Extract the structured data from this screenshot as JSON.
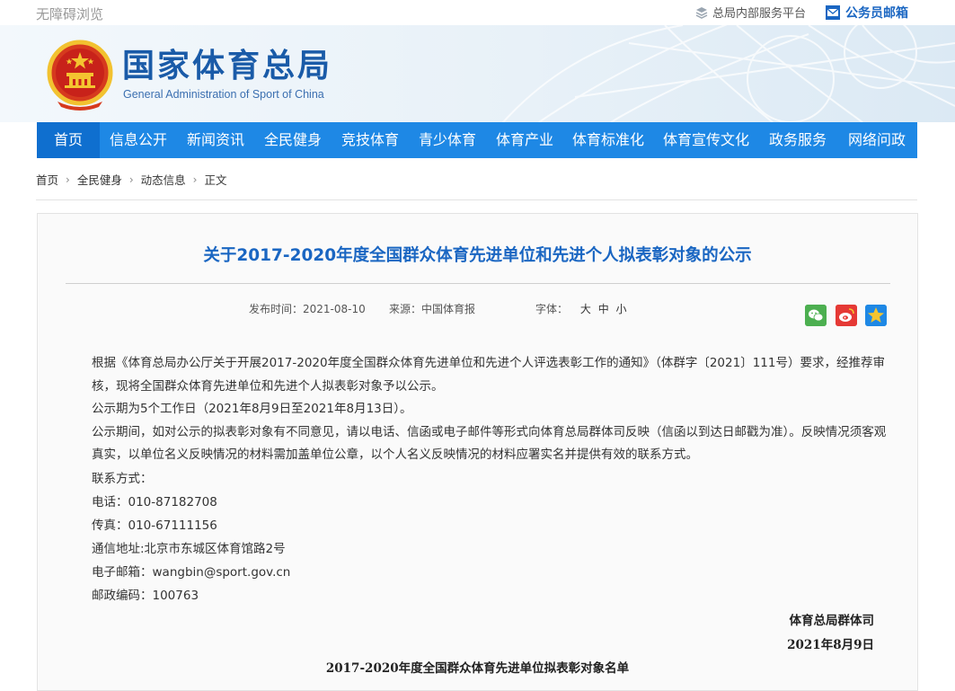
{
  "topbar": {
    "accessibility": "无障碍浏览",
    "internal_platform": "总局内部服务平台",
    "staff_mail": "公务员邮箱"
  },
  "header": {
    "title": "国家体育总局",
    "subtitle": "General Administration of Sport of China"
  },
  "nav": {
    "items": [
      "首页",
      "信息公开",
      "新闻资讯",
      "全民健身",
      "竞技体育",
      "青少体育",
      "体育产业",
      "体育标准化",
      "体育宣传文化",
      "政务服务",
      "网络问政"
    ]
  },
  "breadcrumb": {
    "items": [
      "首页",
      "全民健身",
      "动态信息",
      "正文"
    ],
    "separator": "›"
  },
  "article": {
    "title": "关于2017-2020年度全国群众体育先进单位和先进个人拟表彰对象的公示",
    "publish_label": "发布时间：",
    "publish_date": "2021-08-10",
    "source_label": "来源：",
    "source": "中国体育报",
    "font_label": "字体：",
    "font_sizes": [
      "大",
      "中",
      "小"
    ],
    "paragraphs": [
      "根据《体育总局办公厅关于开展2017-2020年度全国群众体育先进单位和先进个人评选表彰工作的通知》（体群字〔2021〕111号）要求，经推荐审核，现将全国群众体育先进单位和先进个人拟表彰对象予以公示。",
      "公示期为5个工作日（2021年8月9日至2021年8月13日）。",
      "公示期间，如对公示的拟表彰对象有不同意见，请以电话、信函或电子邮件等形式向体育总局群体司反映（信函以到达日邮戳为准）。反映情况须客观真实，以单位名义反映情况的材料需加盖单位公章，以个人名义反映情况的材料应署实名并提供有效的联系方式。"
    ],
    "contact_heading": "联系方式：",
    "contacts": [
      "电话：010-87182708",
      "传真：010-67111156",
      "通信地址:北京市东城区体育馆路2号",
      "电子邮箱：wangbin@sport.gov.cn",
      "邮政编码：100763"
    ],
    "signature_org": "体育总局群体司",
    "signature_date": "2021年8月9日",
    "list_title": "2017-2020年度全国群众体育先进单位拟表彰对象名单"
  },
  "colors": {
    "nav_bg": "#1e88e5",
    "title_blue": "#1a66c2",
    "brand_blue": "#1a5ba8"
  },
  "icons": [
    "layers-icon",
    "mail-icon",
    "national-emblem-icon",
    "wechat-icon",
    "weibo-icon",
    "qzone-icon"
  ]
}
